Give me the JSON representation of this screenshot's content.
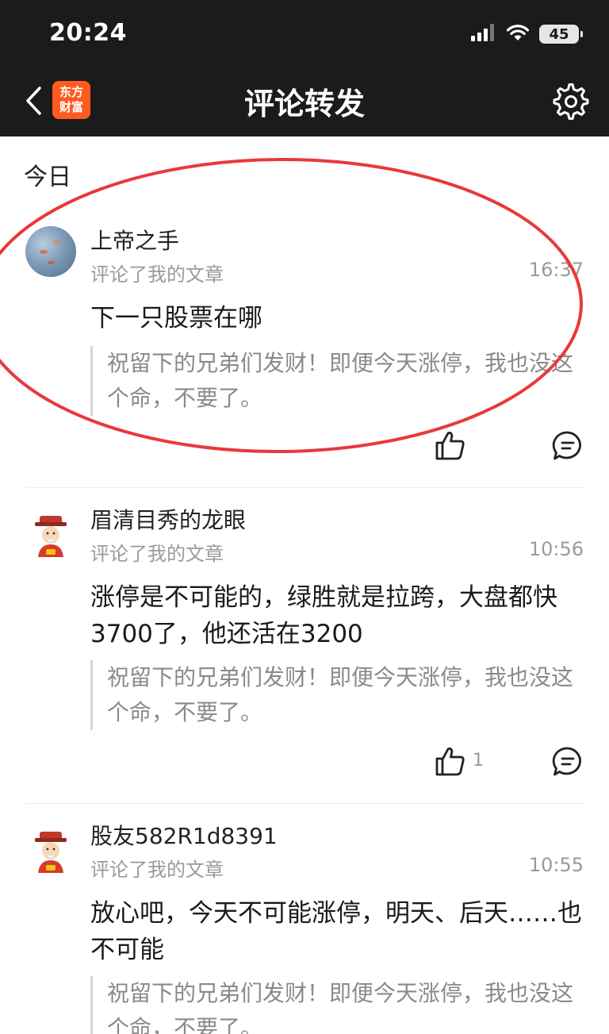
{
  "status_bar": {
    "time": "20:24",
    "battery": "45"
  },
  "nav": {
    "logo_line1": "东方",
    "logo_line2": "财富",
    "title": "评论转发"
  },
  "section_label": "今日",
  "items": [
    {
      "username": "上帝之手",
      "action": "评论了我的文章",
      "time": "16:37",
      "comment": "下一只股票在哪",
      "quote": "祝留下的兄弟们发财！即便今天涨停，我也没这个命，不要了。",
      "likes": ""
    },
    {
      "username": "眉清目秀的龙眼",
      "action": "评论了我的文章",
      "time": "10:56",
      "comment": "涨停是不可能的，绿胜就是拉跨，大盘都快3700了，他还活在3200",
      "quote": "祝留下的兄弟们发财！即便今天涨停，我也没这个命，不要了。",
      "likes": "1"
    },
    {
      "username": "股友582R1d8391",
      "action": "评论了我的文章",
      "time": "10:55",
      "comment": "放心吧，今天不可能涨停，明天、后天……也不可能",
      "quote": "祝留下的兄弟们发财！即便今天涨停，我也没这个命，不要了。",
      "likes": ""
    }
  ],
  "colors": {
    "header_bg": "#1b1b1b",
    "logo_bg": "#ff5a1f",
    "annotation_red": "#e8393a",
    "muted_text": "#9a9a9a"
  },
  "icons": [
    "back-arrow-icon",
    "gear-icon",
    "thumbs-up-icon",
    "comment-bubble-icon",
    "signal-icon",
    "wifi-icon",
    "battery-icon"
  ]
}
